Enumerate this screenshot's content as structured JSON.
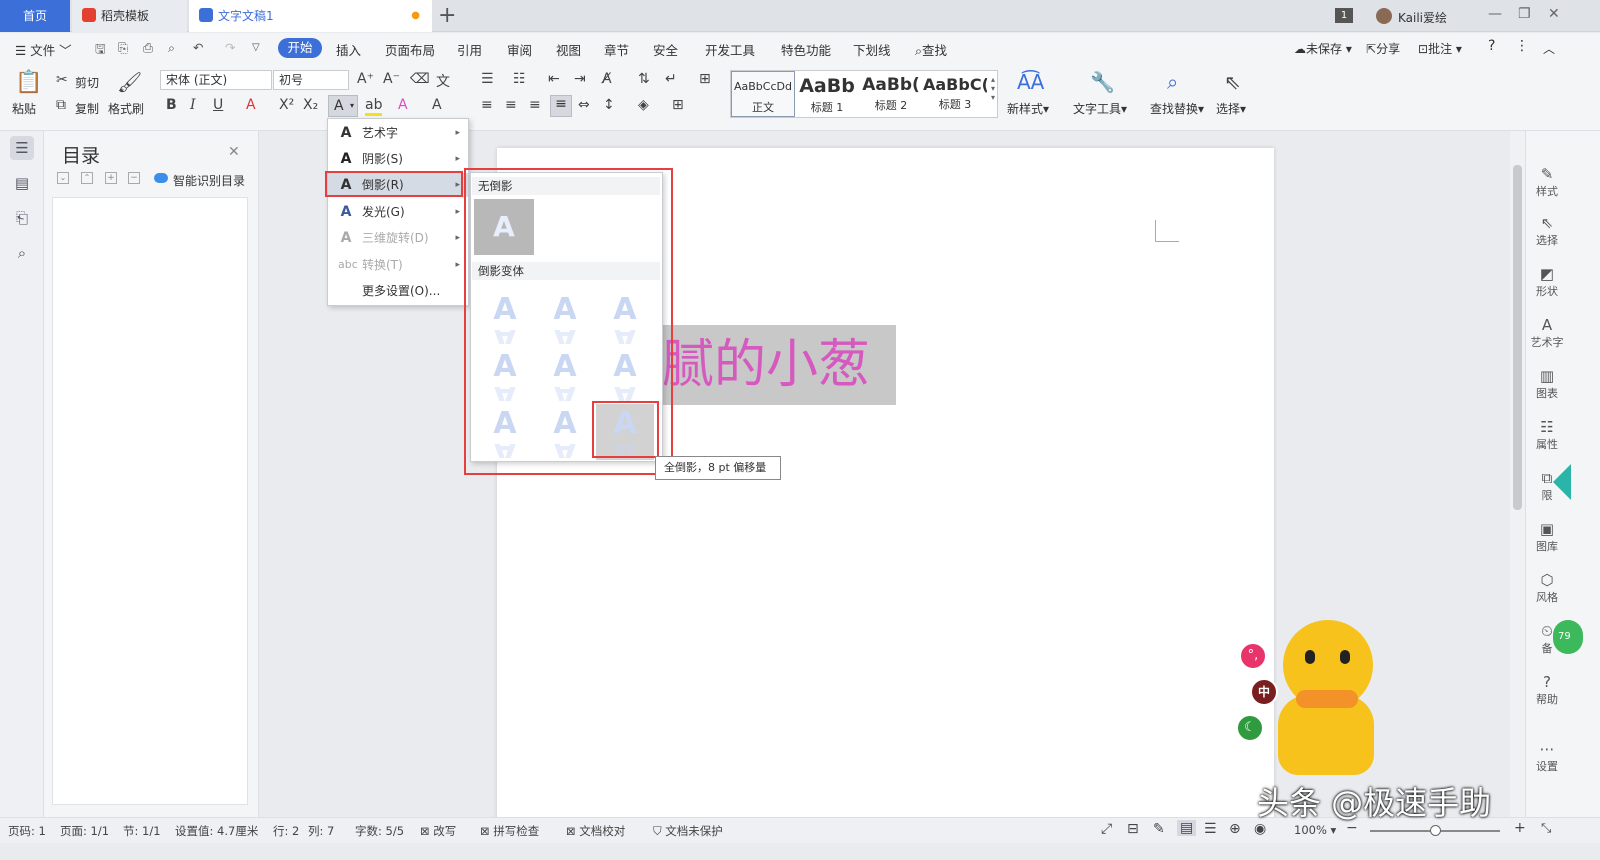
{
  "titlebar": {
    "tab_home": "首页",
    "tab_docer": "稻壳模板",
    "tab_doc": "文字文稿1",
    "badge": "1",
    "user": "Kaili爱绘"
  },
  "menubar": {
    "file": "文件",
    "items": [
      "开始",
      "插入",
      "页面布局",
      "引用",
      "审阅",
      "视图",
      "章节",
      "安全",
      "开发工具",
      "特色功能",
      "下划线",
      "查找"
    ],
    "unsaved": "未保存",
    "share": "分享",
    "comment": "批注"
  },
  "ribbon": {
    "paste": "粘贴",
    "cut": "剪切",
    "copy": "复制",
    "format_painter": "格式刷",
    "font_name": "宋体 (正文)",
    "font_size": "初号",
    "styles": [
      {
        "preview": "AaBbCcDd",
        "label": "正文"
      },
      {
        "preview": "AaBb",
        "label": "标题 1"
      },
      {
        "preview": "AaBb(",
        "label": "标题 2"
      },
      {
        "preview": "AaBbC(",
        "label": "标题 3"
      }
    ],
    "new_style": "新样式",
    "text_tools": "文字工具",
    "find_replace": "查找替换",
    "select": "选择"
  },
  "nav": {
    "title": "目录",
    "smart_toc": "智能识别目录"
  },
  "document": {
    "selected_text": "腻的小葱"
  },
  "effects_menu": {
    "items": [
      {
        "icon": "A",
        "label": "艺术字",
        "arrow": "▸",
        "disabled": false
      },
      {
        "icon": "A",
        "label": "阴影(S)",
        "arrow": "▸",
        "disabled": false
      },
      {
        "icon": "A",
        "label": "倒影(R)",
        "arrow": "▸",
        "disabled": false
      },
      {
        "icon": "A",
        "label": "发光(G)",
        "arrow": "▸",
        "disabled": false
      },
      {
        "icon": "A",
        "label": "三维旋转(D)",
        "arrow": "▸",
        "disabled": true
      },
      {
        "icon": "abc",
        "label": "转换(T)",
        "arrow": "▸",
        "disabled": true
      },
      {
        "icon": "",
        "label": "更多设置(O)...",
        "arrow": "",
        "disabled": false
      }
    ]
  },
  "reflection_menu": {
    "no_reflection": "无倒影",
    "variants": "倒影变体",
    "tooltip": "全倒影，8 pt 偏移量"
  },
  "right_rail": {
    "items": [
      "样式",
      "选择",
      "形状",
      "艺术字",
      "图表",
      "属性",
      "限",
      "图库",
      "风格",
      "备",
      "帮助",
      "设置"
    ]
  },
  "statusbar": {
    "page": "页码: 1",
    "pages": "页面: 1/1",
    "section": "节: 1/1",
    "setting": "设置值: 4.7厘米",
    "row": "行: 2",
    "col": "列: 7",
    "words": "字数: 5/5",
    "revise": "改写",
    "spell": "拼写检查",
    "proof": "文档校对",
    "protect": "文档未保护",
    "zoom": "100%"
  },
  "watermark": "头条 @极速手助",
  "colors": {
    "accent": "#3d6fd9",
    "highlight_red": "#e53f3f",
    "text_pink": "#d659c0"
  }
}
